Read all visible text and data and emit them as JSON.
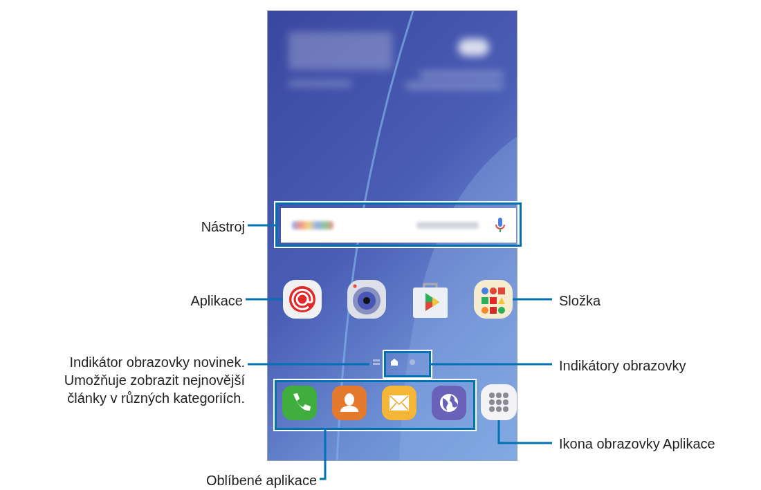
{
  "callouts": [
    {
      "text": "Nástroj"
    },
    {
      "text": "Aplikace"
    },
    {
      "text": "Složka"
    },
    {
      "text": "Indikátor obrazovky novinek. Umožňuje zobrazit nejnovější články v různých kategoriích."
    },
    {
      "text": "Indikátory obrazovky"
    },
    {
      "text": "Ikona obrazovky Aplikace"
    },
    {
      "text": "Oblíbené aplikace"
    }
  ],
  "page_indicator": [
    {
      "kind": "news",
      "selected": false
    },
    {
      "kind": "home",
      "selected": true
    },
    {
      "kind": "dot",
      "selected": false
    }
  ]
}
